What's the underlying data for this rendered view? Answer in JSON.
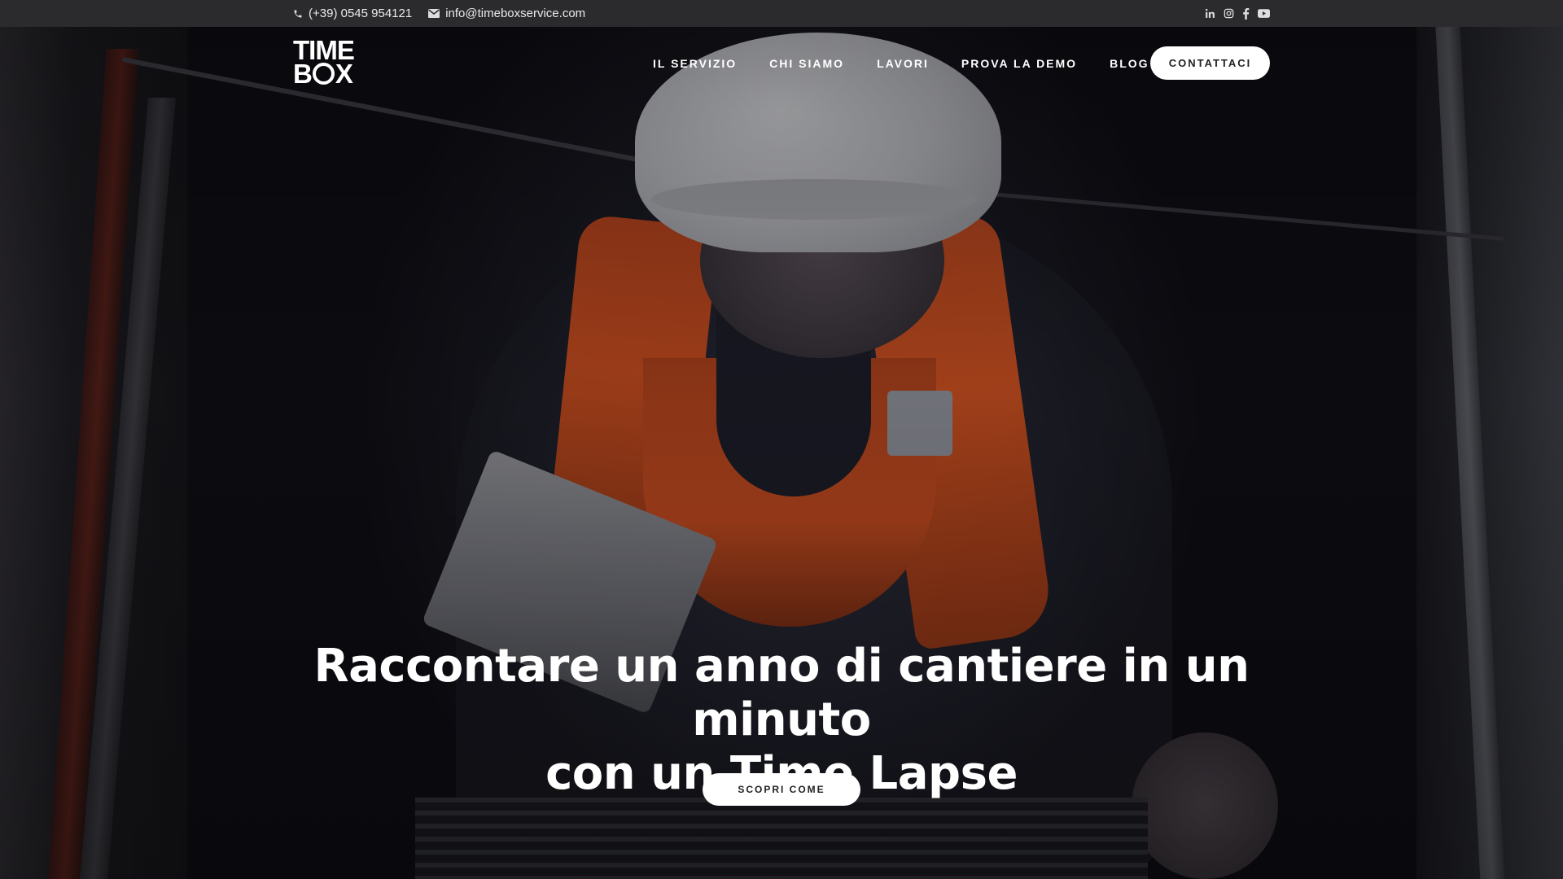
{
  "topbar": {
    "phone": "(+39) 0545 954121",
    "email": "info@timeboxservice.com",
    "phone_icon": "phone-icon",
    "email_icon": "envelope-icon",
    "social": [
      "linkedin-icon",
      "instagram-icon",
      "facebook-icon",
      "youtube-icon"
    ]
  },
  "brand": {
    "logo_line1": "TIME",
    "logo_line2_a": "B",
    "logo_line2_b": "X"
  },
  "nav": {
    "items": [
      "IL SERVIZIO",
      "CHI SIAMO",
      "LAVORI",
      "PROVA LA DEMO",
      "BLOG"
    ],
    "cta": "CONTATTACI"
  },
  "hero": {
    "headline_line1": "Raccontare un anno di cantiere in un minuto",
    "headline_line2": "con un Time Lapse",
    "button": "SCOPRI COME"
  },
  "colors": {
    "topbar_bg": "#2b2b2e",
    "button_bg": "#ffffff",
    "button_text": "#222222"
  }
}
